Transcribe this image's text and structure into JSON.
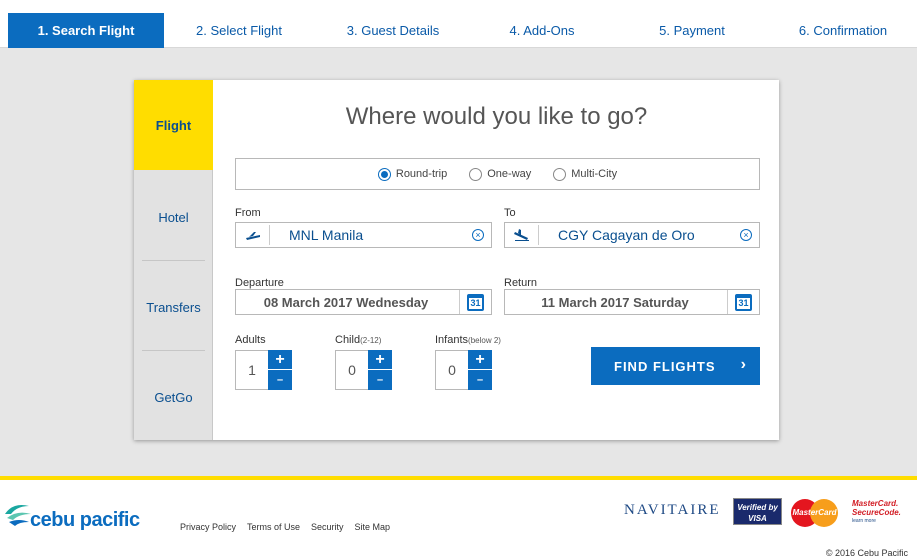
{
  "steps": [
    "1. Search Flight",
    "2. Select Flight",
    "3. Guest Details",
    "4. Add-Ons",
    "5. Payment",
    "6. Confirmation"
  ],
  "side": {
    "flight": "Flight",
    "hotel": "Hotel",
    "transfers": "Transfers",
    "getgo": "GetGo"
  },
  "headline": "Where would you like to go?",
  "trip": {
    "round": "Round-trip",
    "oneway": "One-way",
    "multi": "Multi-City",
    "selected": "Round-trip"
  },
  "from": {
    "label": "From",
    "value": "MNL Manila"
  },
  "to": {
    "label": "To",
    "value": "CGY Cagayan de Oro"
  },
  "departure": {
    "label": "Departure",
    "value": "08 March 2017 Wednesday"
  },
  "return": {
    "label": "Return",
    "value": "11 March 2017 Saturday"
  },
  "calendar_day": "31",
  "adults": {
    "label": "Adults",
    "value": "1"
  },
  "child": {
    "label": "Child",
    "sub": "(2-12)",
    "value": "0"
  },
  "infants": {
    "label": "Infants",
    "sub": "(below 2)",
    "value": "0"
  },
  "stepper": {
    "plus": "+",
    "minus": "–"
  },
  "find_button": "FIND FLIGHTS",
  "footer": {
    "logo": "cebu pacific",
    "links": [
      "Privacy Policy",
      "Terms of Use",
      "Security",
      "Site Map"
    ],
    "navitaire": "NAVITAIRE",
    "visa": "Verified by VISA",
    "mastercard": "MasterCard",
    "securecode_1": "MasterCard.",
    "securecode_2": "SecureCode.",
    "securecode_3": "learn more",
    "copyright": "© 2016 Cebu Pacific"
  },
  "colors": {
    "brand_blue": "#0b6cbf",
    "brand_yellow": "#ffdd00"
  }
}
